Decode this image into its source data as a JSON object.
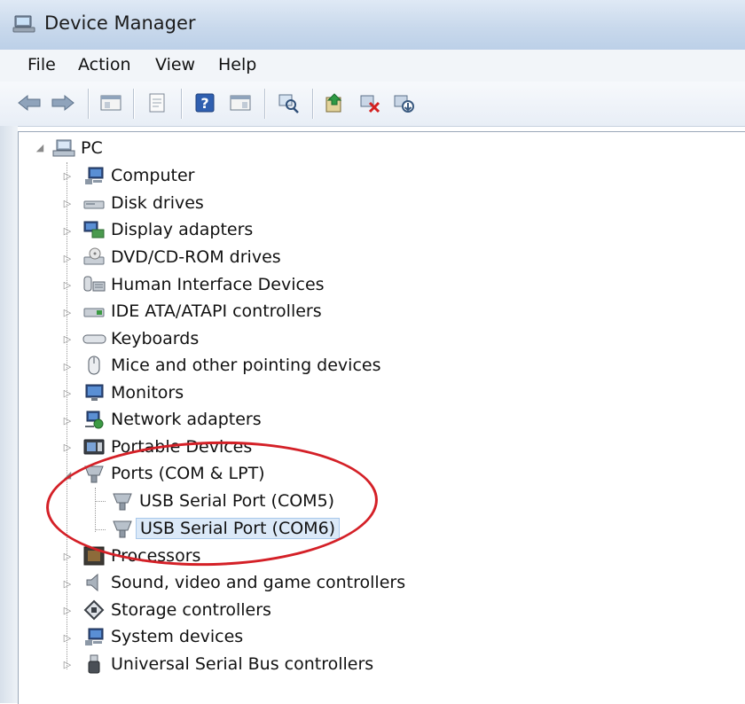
{
  "window": {
    "title": "Device Manager"
  },
  "menu": [
    "File",
    "Action",
    "View",
    "Help"
  ],
  "toolbar": {
    "buttons": [
      "back-icon",
      "forward-icon",
      "show-hide-console-tree-icon",
      "properties-icon",
      "help-icon",
      "action-pane-icon",
      "scan-hardware-icon",
      "update-driver-icon",
      "uninstall-device-icon",
      "disable-device-icon"
    ]
  },
  "tree": {
    "root": "PC",
    "categories": [
      "Computer",
      "Disk drives",
      "Display adapters",
      "DVD/CD-ROM drives",
      "Human Interface Devices",
      "IDE ATA/ATAPI controllers",
      "Keyboards",
      "Mice and other pointing devices",
      "Monitors",
      "Network adapters",
      "Portable Devices",
      "Ports (COM & LPT)",
      "Processors",
      "Sound, video and game controllers",
      "Storage controllers",
      "System devices",
      "Universal Serial Bus controllers"
    ],
    "ports_children": [
      "USB Serial Port (COM5)",
      "USB Serial Port (COM6)"
    ],
    "selected": "USB Serial Port (COM6)",
    "expanded": [
      "PC",
      "Ports (COM & LPT)"
    ]
  },
  "colors": {
    "annotation_ellipse": "#d42027",
    "selection_bg": "#dbe9f8"
  }
}
